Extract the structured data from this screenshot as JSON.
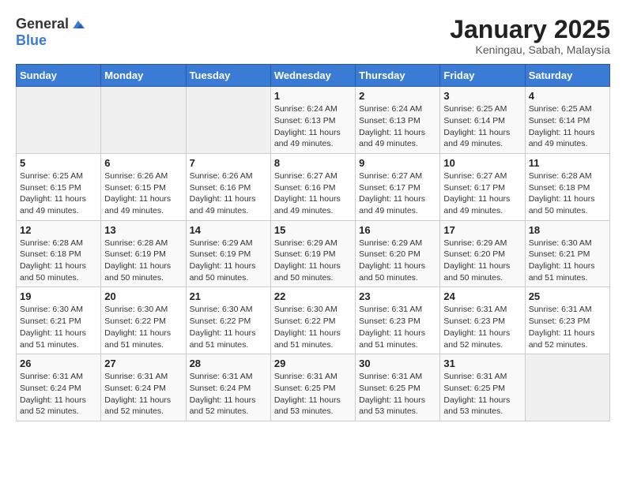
{
  "header": {
    "logo_general": "General",
    "logo_blue": "Blue",
    "month_title": "January 2025",
    "location": "Keningau, Sabah, Malaysia"
  },
  "weekdays": [
    "Sunday",
    "Monday",
    "Tuesday",
    "Wednesday",
    "Thursday",
    "Friday",
    "Saturday"
  ],
  "weeks": [
    [
      {
        "day": "",
        "sunrise": "",
        "sunset": "",
        "daylight": ""
      },
      {
        "day": "",
        "sunrise": "",
        "sunset": "",
        "daylight": ""
      },
      {
        "day": "",
        "sunrise": "",
        "sunset": "",
        "daylight": ""
      },
      {
        "day": "1",
        "sunrise": "Sunrise: 6:24 AM",
        "sunset": "Sunset: 6:13 PM",
        "daylight": "Daylight: 11 hours and 49 minutes."
      },
      {
        "day": "2",
        "sunrise": "Sunrise: 6:24 AM",
        "sunset": "Sunset: 6:13 PM",
        "daylight": "Daylight: 11 hours and 49 minutes."
      },
      {
        "day": "3",
        "sunrise": "Sunrise: 6:25 AM",
        "sunset": "Sunset: 6:14 PM",
        "daylight": "Daylight: 11 hours and 49 minutes."
      },
      {
        "day": "4",
        "sunrise": "Sunrise: 6:25 AM",
        "sunset": "Sunset: 6:14 PM",
        "daylight": "Daylight: 11 hours and 49 minutes."
      }
    ],
    [
      {
        "day": "5",
        "sunrise": "Sunrise: 6:25 AM",
        "sunset": "Sunset: 6:15 PM",
        "daylight": "Daylight: 11 hours and 49 minutes."
      },
      {
        "day": "6",
        "sunrise": "Sunrise: 6:26 AM",
        "sunset": "Sunset: 6:15 PM",
        "daylight": "Daylight: 11 hours and 49 minutes."
      },
      {
        "day": "7",
        "sunrise": "Sunrise: 6:26 AM",
        "sunset": "Sunset: 6:16 PM",
        "daylight": "Daylight: 11 hours and 49 minutes."
      },
      {
        "day": "8",
        "sunrise": "Sunrise: 6:27 AM",
        "sunset": "Sunset: 6:16 PM",
        "daylight": "Daylight: 11 hours and 49 minutes."
      },
      {
        "day": "9",
        "sunrise": "Sunrise: 6:27 AM",
        "sunset": "Sunset: 6:17 PM",
        "daylight": "Daylight: 11 hours and 49 minutes."
      },
      {
        "day": "10",
        "sunrise": "Sunrise: 6:27 AM",
        "sunset": "Sunset: 6:17 PM",
        "daylight": "Daylight: 11 hours and 49 minutes."
      },
      {
        "day": "11",
        "sunrise": "Sunrise: 6:28 AM",
        "sunset": "Sunset: 6:18 PM",
        "daylight": "Daylight: 11 hours and 50 minutes."
      }
    ],
    [
      {
        "day": "12",
        "sunrise": "Sunrise: 6:28 AM",
        "sunset": "Sunset: 6:18 PM",
        "daylight": "Daylight: 11 hours and 50 minutes."
      },
      {
        "day": "13",
        "sunrise": "Sunrise: 6:28 AM",
        "sunset": "Sunset: 6:19 PM",
        "daylight": "Daylight: 11 hours and 50 minutes."
      },
      {
        "day": "14",
        "sunrise": "Sunrise: 6:29 AM",
        "sunset": "Sunset: 6:19 PM",
        "daylight": "Daylight: 11 hours and 50 minutes."
      },
      {
        "day": "15",
        "sunrise": "Sunrise: 6:29 AM",
        "sunset": "Sunset: 6:19 PM",
        "daylight": "Daylight: 11 hours and 50 minutes."
      },
      {
        "day": "16",
        "sunrise": "Sunrise: 6:29 AM",
        "sunset": "Sunset: 6:20 PM",
        "daylight": "Daylight: 11 hours and 50 minutes."
      },
      {
        "day": "17",
        "sunrise": "Sunrise: 6:29 AM",
        "sunset": "Sunset: 6:20 PM",
        "daylight": "Daylight: 11 hours and 50 minutes."
      },
      {
        "day": "18",
        "sunrise": "Sunrise: 6:30 AM",
        "sunset": "Sunset: 6:21 PM",
        "daylight": "Daylight: 11 hours and 51 minutes."
      }
    ],
    [
      {
        "day": "19",
        "sunrise": "Sunrise: 6:30 AM",
        "sunset": "Sunset: 6:21 PM",
        "daylight": "Daylight: 11 hours and 51 minutes."
      },
      {
        "day": "20",
        "sunrise": "Sunrise: 6:30 AM",
        "sunset": "Sunset: 6:22 PM",
        "daylight": "Daylight: 11 hours and 51 minutes."
      },
      {
        "day": "21",
        "sunrise": "Sunrise: 6:30 AM",
        "sunset": "Sunset: 6:22 PM",
        "daylight": "Daylight: 11 hours and 51 minutes."
      },
      {
        "day": "22",
        "sunrise": "Sunrise: 6:30 AM",
        "sunset": "Sunset: 6:22 PM",
        "daylight": "Daylight: 11 hours and 51 minutes."
      },
      {
        "day": "23",
        "sunrise": "Sunrise: 6:31 AM",
        "sunset": "Sunset: 6:23 PM",
        "daylight": "Daylight: 11 hours and 51 minutes."
      },
      {
        "day": "24",
        "sunrise": "Sunrise: 6:31 AM",
        "sunset": "Sunset: 6:23 PM",
        "daylight": "Daylight: 11 hours and 52 minutes."
      },
      {
        "day": "25",
        "sunrise": "Sunrise: 6:31 AM",
        "sunset": "Sunset: 6:23 PM",
        "daylight": "Daylight: 11 hours and 52 minutes."
      }
    ],
    [
      {
        "day": "26",
        "sunrise": "Sunrise: 6:31 AM",
        "sunset": "Sunset: 6:24 PM",
        "daylight": "Daylight: 11 hours and 52 minutes."
      },
      {
        "day": "27",
        "sunrise": "Sunrise: 6:31 AM",
        "sunset": "Sunset: 6:24 PM",
        "daylight": "Daylight: 11 hours and 52 minutes."
      },
      {
        "day": "28",
        "sunrise": "Sunrise: 6:31 AM",
        "sunset": "Sunset: 6:24 PM",
        "daylight": "Daylight: 11 hours and 52 minutes."
      },
      {
        "day": "29",
        "sunrise": "Sunrise: 6:31 AM",
        "sunset": "Sunset: 6:25 PM",
        "daylight": "Daylight: 11 hours and 53 minutes."
      },
      {
        "day": "30",
        "sunrise": "Sunrise: 6:31 AM",
        "sunset": "Sunset: 6:25 PM",
        "daylight": "Daylight: 11 hours and 53 minutes."
      },
      {
        "day": "31",
        "sunrise": "Sunrise: 6:31 AM",
        "sunset": "Sunset: 6:25 PM",
        "daylight": "Daylight: 11 hours and 53 minutes."
      },
      {
        "day": "",
        "sunrise": "",
        "sunset": "",
        "daylight": ""
      }
    ]
  ]
}
